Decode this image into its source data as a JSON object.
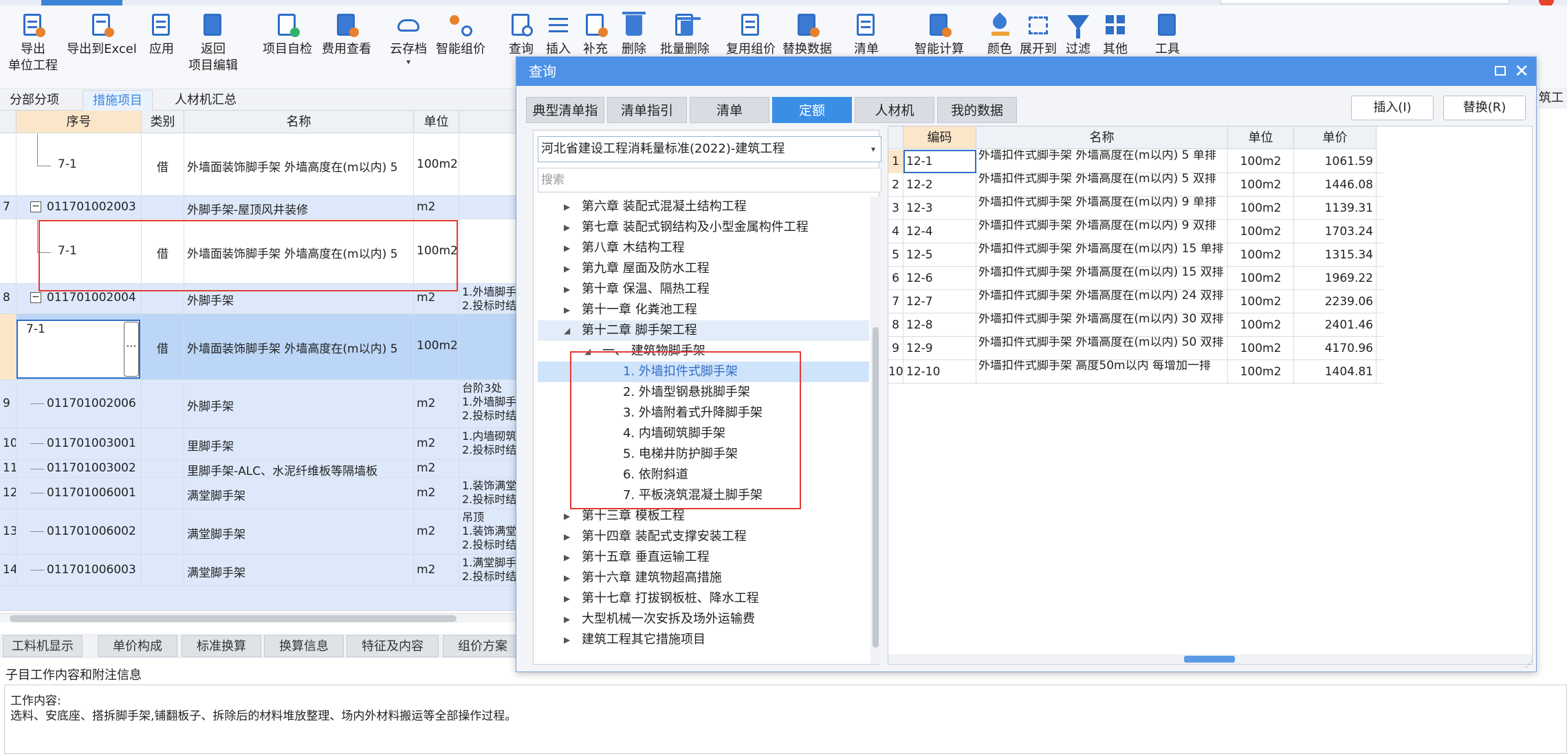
{
  "ribbon": {
    "buttons": [
      {
        "label": "导出",
        "sub": "单位工程",
        "icon": "export-icon"
      },
      {
        "label": "导出到Excel",
        "icon": "export-excel-icon"
      },
      {
        "label": "应用",
        "icon": "apply-icon"
      },
      {
        "label": "返回",
        "sub": "项目编辑",
        "icon": "return-icon"
      },
      {
        "label": "项目自检",
        "icon": "self-check-icon"
      },
      {
        "label": "费用查看",
        "icon": "cost-view-icon"
      },
      {
        "label": "云存档",
        "icon": "cloud-archive-icon"
      },
      {
        "label": "智能组价",
        "icon": "smart-pricing-icon"
      },
      {
        "label": "查询",
        "icon": "query-icon"
      },
      {
        "label": "插入",
        "icon": "insert-icon"
      },
      {
        "label": "补充",
        "icon": "supplement-icon"
      },
      {
        "label": "删除",
        "icon": "delete-icon"
      },
      {
        "label": "批量删除",
        "icon": "batch-delete-icon"
      },
      {
        "label": "复用组价",
        "icon": "reuse-pricing-icon"
      },
      {
        "label": "替换数据",
        "icon": "replace-data-icon"
      },
      {
        "label": "清单",
        "icon": "list-icon"
      },
      {
        "label": "智能计算",
        "icon": "smart-calc-icon"
      },
      {
        "label": "颜色",
        "icon": "color-icon"
      },
      {
        "label": "展开到",
        "icon": "expand-icon"
      },
      {
        "label": "过滤",
        "icon": "filter-icon"
      },
      {
        "label": "其他",
        "icon": "other-icon"
      },
      {
        "label": "工具",
        "icon": "tools-icon"
      }
    ]
  },
  "subtabs": [
    "分部分项",
    "措施项目",
    "人材机汇总"
  ],
  "grid": {
    "headers": [
      "序号",
      "类别",
      "名称",
      "单位"
    ],
    "rows": [
      {
        "no": "",
        "code": "7-1",
        "type": "借",
        "name": "外墙面装饰脚手架 外墙高度在(m以内) 5",
        "unit": "100m2",
        "desc": ""
      },
      {
        "no": "7",
        "code": "011701002003",
        "type": "",
        "name": "外脚手架-屋顶风井装修",
        "unit": "m2",
        "desc": ""
      },
      {
        "no": "",
        "code": "7-1",
        "type": "借",
        "name": "外墙面装饰脚手架 外墙高度在(m以内) 5",
        "unit": "100m2",
        "desc": ""
      },
      {
        "no": "8",
        "code": "011701002004",
        "type": "",
        "name": "外脚手架",
        "unit": "m2",
        "desc": "1.外墙脚手\n2.投标时结"
      },
      {
        "no": "",
        "code": "7-1",
        "type": "借",
        "name": "外墙面装饰脚手架 外墙高度在(m以内) 5",
        "unit": "100m2",
        "desc": ""
      },
      {
        "no": "9",
        "code": "011701002006",
        "type": "",
        "name": "外脚手架",
        "unit": "m2",
        "desc": "台阶3处\n1.外墙脚手\n2.投标时结"
      },
      {
        "no": "10",
        "code": "011701003001",
        "type": "",
        "name": "里脚手架",
        "unit": "m2",
        "desc": "1.内墙砌筑\n2.投标时结"
      },
      {
        "no": "11",
        "code": "011701003002",
        "type": "",
        "name": "里脚手架-ALC、水泥纤维板等隔墙板",
        "unit": "m2",
        "desc": ""
      },
      {
        "no": "12",
        "code": "011701006001",
        "type": "",
        "name": "满堂脚手架",
        "unit": "m2",
        "desc": "1.装饰满堂\n2.投标时结"
      },
      {
        "no": "13",
        "code": "011701006002",
        "type": "",
        "name": "满堂脚手架",
        "unit": "m2",
        "desc": "吊顶\n1.装饰满堂\n2.投标时结"
      },
      {
        "no": "14",
        "code": "011701006003",
        "type": "",
        "name": "满堂脚手架",
        "unit": "m2",
        "desc": "1.满堂脚手\n2.投标时结"
      }
    ],
    "edit_value": "7-1"
  },
  "bottom_tabs": [
    "工料机显示",
    "单价构成",
    "标准换算",
    "换算信息",
    "特征及内容",
    "组价方案"
  ],
  "bottom": {
    "title": "子目工作内容和附注信息",
    "line1": "工作内容:",
    "line2": "选料、安底座、搭拆脚手架,铺翻板子、拆除后的材料堆放整理、场内外材料搬运等全部操作过程。"
  },
  "right_edge_label": "筑工程",
  "dialog": {
    "title": "查询",
    "tabs": [
      "典型清单指引",
      "清单指引",
      "清单",
      "定额",
      "人材机",
      "我的数据"
    ],
    "active_tab": "定额",
    "insert_button": "插入(I)",
    "replace_button": "替换(R)",
    "standard": "河北省建设工程消耗量标准(2022)-建筑工程",
    "search_placeholder": "搜索",
    "tree": [
      {
        "label": "第六章 装配式混凝土结构工程",
        "level": 0,
        "arrow": "▶"
      },
      {
        "label": "第七章 装配式钢结构及小型金属构件工程",
        "level": 0,
        "arrow": "▶"
      },
      {
        "label": "第八章 木结构工程",
        "level": 0,
        "arrow": "▶"
      },
      {
        "label": "第九章 屋面及防水工程",
        "level": 0,
        "arrow": "▶"
      },
      {
        "label": "第十章 保温、隔热工程",
        "level": 0,
        "arrow": "▶"
      },
      {
        "label": "第十一章 化粪池工程",
        "level": 0,
        "arrow": "▶"
      },
      {
        "label": "第十二章 脚手架工程",
        "level": 0,
        "arrow": "◢"
      },
      {
        "label": "一、 建筑物脚手架",
        "level": 1,
        "arrow": "◢"
      },
      {
        "label": "1. 外墙扣件式脚手架",
        "level": 2,
        "arrow": ""
      },
      {
        "label": "2. 外墙型钢悬挑脚手架",
        "level": 2,
        "arrow": ""
      },
      {
        "label": "3. 外墙附着式升降脚手架",
        "level": 2,
        "arrow": ""
      },
      {
        "label": "4. 内墙砌筑脚手架",
        "level": 2,
        "arrow": ""
      },
      {
        "label": "5. 电梯井防护脚手架",
        "level": 2,
        "arrow": ""
      },
      {
        "label": "6. 依附斜道",
        "level": 2,
        "arrow": ""
      },
      {
        "label": "7. 平板浇筑混凝土脚手架",
        "level": 2,
        "arrow": ""
      },
      {
        "label": "第十三章 模板工程",
        "level": 0,
        "arrow": "▶"
      },
      {
        "label": "第十四章 装配式支撑安装工程",
        "level": 0,
        "arrow": "▶"
      },
      {
        "label": "第十五章 垂直运输工程",
        "level": 0,
        "arrow": "▶"
      },
      {
        "label": "第十六章 建筑物超高措施",
        "level": 0,
        "arrow": "▶"
      },
      {
        "label": "第十七章 打拔钢板桩、降水工程",
        "level": 0,
        "arrow": "▶"
      },
      {
        "label": "大型机械一次安拆及场外运输费",
        "level": 0,
        "arrow": "▶"
      },
      {
        "label": "建筑工程其它措施项目",
        "level": 0,
        "arrow": "▶"
      }
    ],
    "result_headers": [
      "编码",
      "名称",
      "单位",
      "单价"
    ],
    "results": [
      {
        "no": "1",
        "code": "12-1",
        "name": "外墙扣件式脚手架 外墙高度在(m以内) 5 单排",
        "unit": "100m2",
        "price": "1061.59"
      },
      {
        "no": "2",
        "code": "12-2",
        "name": "外墙扣件式脚手架 外墙高度在(m以内) 5 双排",
        "unit": "100m2",
        "price": "1446.08"
      },
      {
        "no": "3",
        "code": "12-3",
        "name": "外墙扣件式脚手架 外墙高度在(m以内) 9 单排",
        "unit": "100m2",
        "price": "1139.31"
      },
      {
        "no": "4",
        "code": "12-4",
        "name": "外墙扣件式脚手架 外墙高度在(m以内) 9 双排",
        "unit": "100m2",
        "price": "1703.24"
      },
      {
        "no": "5",
        "code": "12-5",
        "name": "外墙扣件式脚手架 外墙高度在(m以内) 15 单排",
        "unit": "100m2",
        "price": "1315.34"
      },
      {
        "no": "6",
        "code": "12-6",
        "name": "外墙扣件式脚手架 外墙高度在(m以内) 15 双排",
        "unit": "100m2",
        "price": "1969.22"
      },
      {
        "no": "7",
        "code": "12-7",
        "name": "外墙扣件式脚手架 外墙高度在(m以内) 24 双排",
        "unit": "100m2",
        "price": "2239.06"
      },
      {
        "no": "8",
        "code": "12-8",
        "name": "外墙扣件式脚手架 外墙高度在(m以内) 30 双排",
        "unit": "100m2",
        "price": "2401.46"
      },
      {
        "no": "9",
        "code": "12-9",
        "name": "外墙扣件式脚手架 外墙高度在(m以内) 50 双排",
        "unit": "100m2",
        "price": "4170.96"
      },
      {
        "no": "10",
        "code": "12-10",
        "name": "外墙扣件式脚手架 高度50m以内 每增加一排",
        "unit": "100m2",
        "price": "1404.81"
      }
    ]
  },
  "colors": {
    "accent": "#4d92e6",
    "highlight_red": "#e53935",
    "selected_row": "#bcd6f7"
  }
}
